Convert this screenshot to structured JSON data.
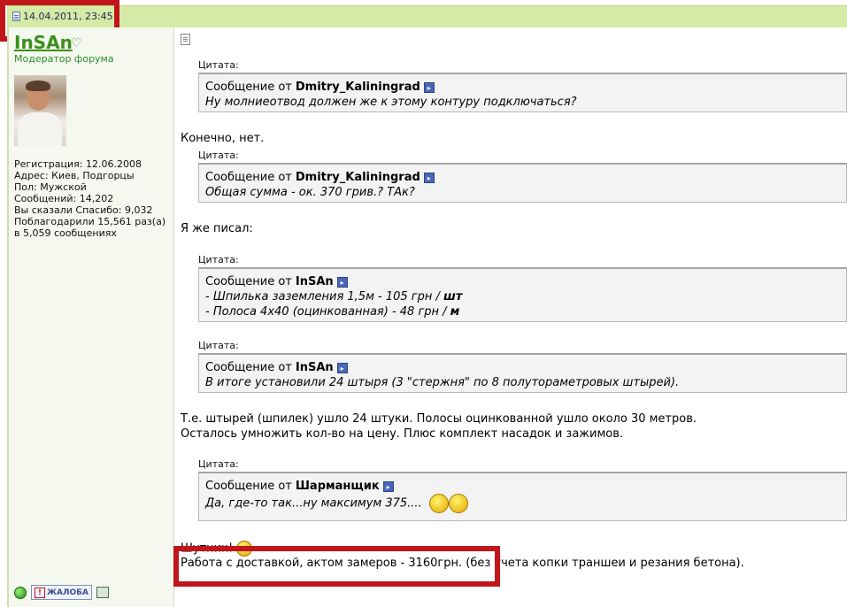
{
  "post": {
    "date": "14.04.2011, 23:45"
  },
  "author": {
    "name": "InSAn",
    "role": "Модератор форума",
    "stats": [
      "Регистрация: 12.06.2008",
      "Адрес: Киев, Подгорцы",
      "Пол: Мужской",
      "Сообщений: 14,202",
      "Вы сказали Спасибо: 9,032",
      "Поблагодарили 15,561 раз(а)",
      "в 5,059 сообщениях"
    ],
    "report_label": "ЖАЛОБА"
  },
  "quote_label": "Цитата:",
  "message_prefix": "Сообщение от",
  "quotes": [
    {
      "author": "Dmitry_Kaliningrad",
      "lines": [
        "Ну молниеотвод должен же к этому контуру подключаться?"
      ]
    },
    {
      "author": "Dmitry_Kaliningrad",
      "lines": [
        "Общая сумма - ок. 370 грив.? ТАк?"
      ]
    },
    {
      "author": "InSAn",
      "lines": [
        "- Шпилька заземления 1,5м - 105 грн / ",
        "- Полоса 4х40 (оцинкованная) - 48 грн / "
      ],
      "units": [
        "шт",
        "м"
      ]
    },
    {
      "author": "InSAn",
      "lines": [
        "В итоге установили 24 штыря (3 \"стержня\" по 8 полутораметровых штырей)."
      ]
    },
    {
      "author": "Шарманщик",
      "lines": [
        "Да, где-то так...ну максимум 375...."
      ]
    }
  ],
  "paragraphs": {
    "p1": "Конечно, нет.",
    "p2": "Я же писал:",
    "p3a": "Т.е. штырей (шпилек) ушло 24 штуки. Полосы оцинкованной ушло около 30 метров.",
    "p3b": "Осталось умножить кол-во на цену. Плюс комплект насадок и зажимов.",
    "p4": "Шутник!",
    "p5": "Работа с доставкой, актом замеров - 3160грн. (без учета копки траншеи и резания бетона)."
  },
  "colors": {
    "highlight": "#c0161b",
    "header_bg": "#d5eaa6",
    "username": "#3b8f1b"
  }
}
